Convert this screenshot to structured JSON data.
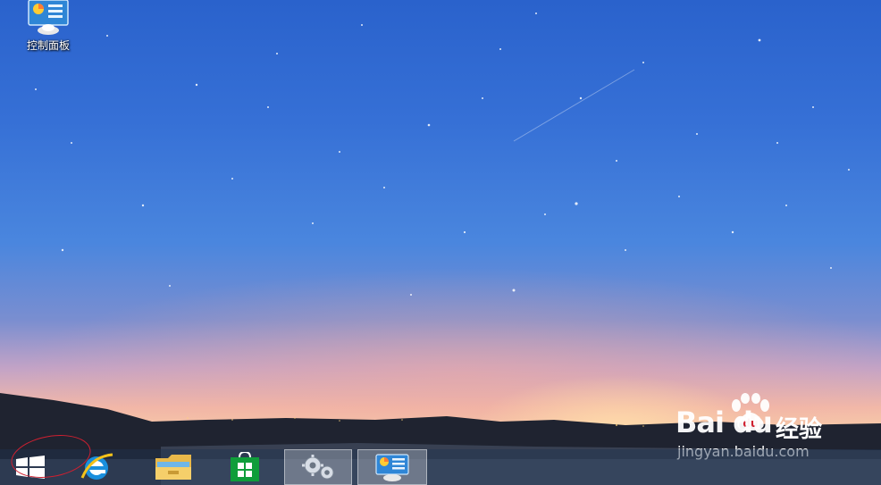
{
  "desktop": {
    "icons": [
      {
        "label": "控制面板",
        "icon": "control-panel-icon"
      }
    ]
  },
  "taskbar": {
    "items": [
      {
        "name": "Start",
        "icon": "windows-logo-icon",
        "active": false
      },
      {
        "name": "Internet Explorer",
        "icon": "ie-icon",
        "active": false
      },
      {
        "name": "File Explorer",
        "icon": "folder-icon",
        "active": false
      },
      {
        "name": "Store",
        "icon": "store-icon",
        "active": false
      },
      {
        "name": "Settings",
        "icon": "gear-icon",
        "active": true
      },
      {
        "name": "Control Panel",
        "icon": "control-panel-icon",
        "active": true
      }
    ]
  },
  "watermark": {
    "brand_latin": "Bai du",
    "brand_cn": "经验",
    "url": "jingyan.baidu.com"
  },
  "colors": {
    "annotation": "#d02030",
    "store_green": "#0f9d3a",
    "ie_blue": "#1a8fdd"
  }
}
